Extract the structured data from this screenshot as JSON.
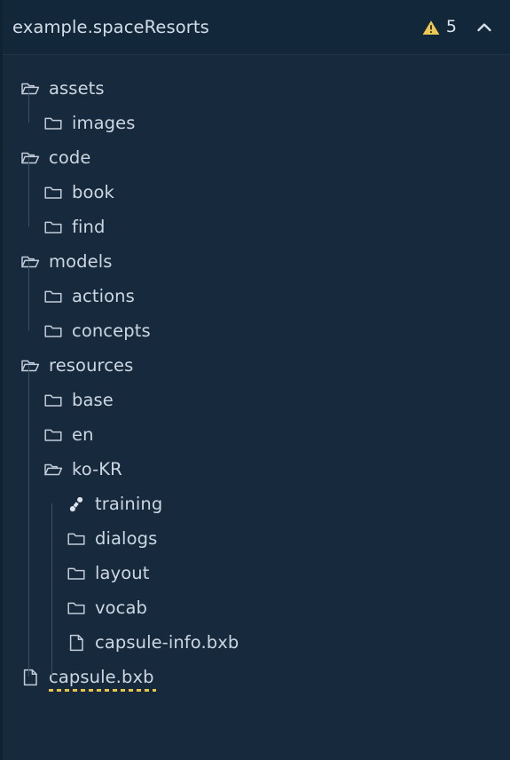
{
  "header": {
    "title": "example.spaceResorts",
    "warning_icon": "warning-triangle-icon",
    "warning_count": "5",
    "collapse_icon": "chevron-up-icon"
  },
  "colors": {
    "background": "#17293c",
    "header_background": "#12273a",
    "text": "#cdd7e3",
    "warning": "#e8c44a",
    "guide_line": "#3c5066",
    "icon_stroke": "#c3cdda"
  },
  "tree": {
    "items": [
      {
        "label": "assets",
        "icon": "folder-open-icon",
        "level": 0,
        "type": "folder",
        "warning": false
      },
      {
        "label": "images",
        "icon": "folder-icon",
        "level": 1,
        "type": "folder",
        "warning": false
      },
      {
        "label": "code",
        "icon": "folder-open-icon",
        "level": 0,
        "type": "folder",
        "warning": false
      },
      {
        "label": "book",
        "icon": "folder-icon",
        "level": 1,
        "type": "folder",
        "warning": false
      },
      {
        "label": "find",
        "icon": "folder-icon",
        "level": 1,
        "type": "folder",
        "warning": false
      },
      {
        "label": "models",
        "icon": "folder-open-icon",
        "level": 0,
        "type": "folder",
        "warning": false
      },
      {
        "label": "actions",
        "icon": "folder-icon",
        "level": 1,
        "type": "folder",
        "warning": false
      },
      {
        "label": "concepts",
        "icon": "folder-icon",
        "level": 1,
        "type": "folder",
        "warning": false
      },
      {
        "label": "resources",
        "icon": "folder-open-icon",
        "level": 0,
        "type": "folder",
        "warning": false
      },
      {
        "label": "base",
        "icon": "folder-icon",
        "level": 1,
        "type": "folder",
        "warning": false
      },
      {
        "label": "en",
        "icon": "folder-icon",
        "level": 1,
        "type": "folder",
        "warning": false
      },
      {
        "label": "ko-KR",
        "icon": "folder-open-icon",
        "level": 1,
        "type": "folder",
        "warning": false
      },
      {
        "label": "training",
        "icon": "dumbbell-icon",
        "level": 2,
        "type": "training",
        "warning": false
      },
      {
        "label": "dialogs",
        "icon": "folder-icon",
        "level": 2,
        "type": "folder",
        "warning": false
      },
      {
        "label": "layout",
        "icon": "folder-icon",
        "level": 2,
        "type": "folder",
        "warning": false
      },
      {
        "label": "vocab",
        "icon": "folder-icon",
        "level": 2,
        "type": "folder",
        "warning": false
      },
      {
        "label": "capsule-info.bxb",
        "icon": "file-icon",
        "level": 2,
        "type": "file",
        "warning": false
      },
      {
        "label": "capsule.bxb",
        "icon": "file-icon",
        "level": 0,
        "type": "file",
        "warning": true
      }
    ]
  }
}
